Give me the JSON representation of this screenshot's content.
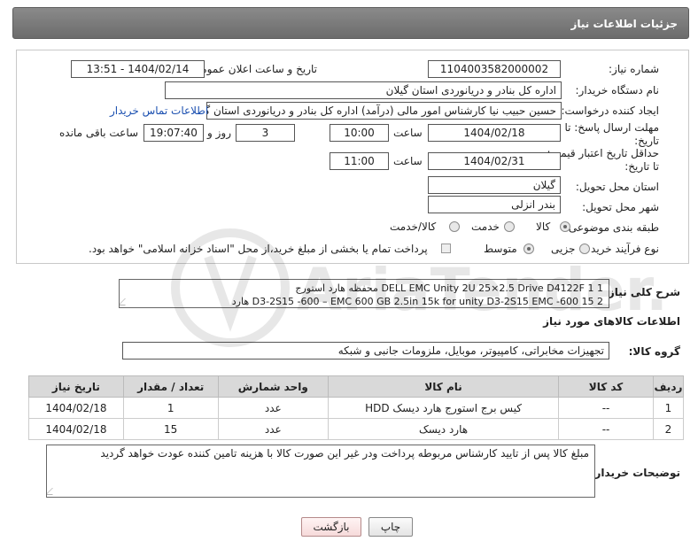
{
  "header": {
    "title": "جزئیات اطلاعات نیاز"
  },
  "form": {
    "need_number": {
      "label": "شماره نیاز:",
      "value": "1104003582000002"
    },
    "announce_datetime": {
      "label": "تاریخ و ساعت اعلان عمومی:",
      "value": "1404/02/14 - 13:51"
    },
    "buyer_org": {
      "label": "نام دستگاه خریدار:",
      "value": "اداره کل بنادر و دریانوردی استان گیلان"
    },
    "requester": {
      "label": "ایجاد کننده درخواست:",
      "value": "حسین حبیب نیا کارشناس امور مالی (درآمد) اداره کل بنادر و دریانوردی استان گ",
      "contact_link": "اطلاعات تماس خریدار"
    },
    "reply_deadline": {
      "label_line1": "مهلت ارسال پاسخ: تا",
      "label_line2": "تاریخ:",
      "date": "1404/02/18",
      "time_label": "ساعت",
      "time": "10:00",
      "days": "3",
      "days_label": "روز و",
      "remaining": "19:07:40",
      "remaining_label": "ساعت باقی مانده"
    },
    "price_validity": {
      "label_line1": "حداقل تاریخ اعتبار قیمت:",
      "label_line2": "تا تاریخ:",
      "date": "1404/02/31",
      "time_label": "ساعت",
      "time": "11:00"
    },
    "delivery_province": {
      "label": "استان محل تحویل:",
      "value": "گیلان"
    },
    "delivery_city": {
      "label": "شهر محل تحویل:",
      "value": "بندر انزلی"
    },
    "category": {
      "label": "طبقه بندی موضوعی:",
      "options": [
        "کالا",
        "خدمت",
        "کالا/خدمت"
      ],
      "selected": "کالا"
    },
    "purchase_type": {
      "label": "نوع فرآیند خرید :",
      "options": [
        "جزیی",
        "متوسط"
      ],
      "selected": "متوسط",
      "note": "پرداخت تمام یا بخشی از مبلغ خرید،از محل \"اسناد خزانه اسلامی\" خواهد بود."
    }
  },
  "description": {
    "label": "شرح کلی نیاز:",
    "line1": "1 DELL EMC Unity 2U 25×2.5 Drive D4122F 1 محفظه هارد استورج",
    "line2": "2 15 600- D3-2S15 -600 – EMC 600 GB 2.5in 15k for unity D3-2S15 EMC هارد"
  },
  "goods_section": {
    "title": "اطلاعات کالاهای مورد نیاز",
    "group_label": "گروه کالا:",
    "group_value": "تجهیزات مخابراتی، کامپیوتر، موبایل، ملزومات جانبی و شبکه"
  },
  "table": {
    "headers": [
      "ردیف",
      "کد کالا",
      "نام کالا",
      "واحد شمارش",
      "تعداد / مقدار",
      "تاریخ نیاز"
    ],
    "rows": [
      [
        "1",
        "--",
        "کیس برج استورج هارد دیسک HDD",
        "عدد",
        "1",
        "1404/02/18"
      ],
      [
        "2",
        "--",
        "هارد دیسک",
        "عدد",
        "15",
        "1404/02/18"
      ]
    ]
  },
  "buyer_notes": {
    "label": "توضیحات خریدار:",
    "text": "مبلغ کالا پس از تایید کارشناس مربوطه پرداخت ودر غیر این صورت کالا با هزینه تامین کننده عودت خواهد گردید"
  },
  "buttons": {
    "print": "چاپ",
    "back": "بازگشت"
  },
  "watermark": {
    "text": "AriaTender.net"
  },
  "colors": {
    "header_bg": "#7a7a7a",
    "link": "#1a4fb0",
    "back_button": "#f6dada",
    "table_header": "#d9d9d9"
  }
}
